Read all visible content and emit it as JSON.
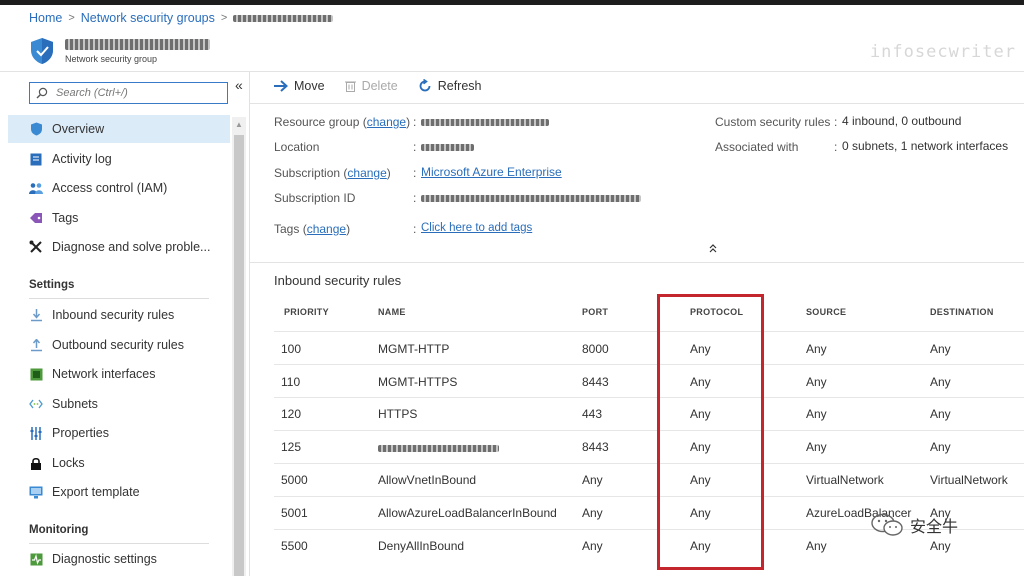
{
  "breadcrumb": {
    "home": "Home",
    "section": "Network security groups"
  },
  "resource": {
    "subtitle": "Network security group"
  },
  "watermark_top": "infosecwriter",
  "watermark_bottom": "安全牛",
  "sidebar": {
    "search_placeholder": "Search (Ctrl+/)",
    "collapse": "«",
    "items": [
      {
        "label": "Overview",
        "icon": "shield-icon"
      },
      {
        "label": "Activity log",
        "icon": "activity-log-icon"
      },
      {
        "label": "Access control (IAM)",
        "icon": "people-icon"
      },
      {
        "label": "Tags",
        "icon": "tag-icon"
      },
      {
        "label": "Diagnose and solve proble...",
        "icon": "wrench-icon"
      }
    ],
    "settings_title": "Settings",
    "settings_items": [
      {
        "label": "Inbound security rules",
        "icon": "inbound-icon"
      },
      {
        "label": "Outbound security rules",
        "icon": "outbound-icon"
      },
      {
        "label": "Network interfaces",
        "icon": "network-interface-icon"
      },
      {
        "label": "Subnets",
        "icon": "subnet-icon"
      },
      {
        "label": "Properties",
        "icon": "properties-icon"
      },
      {
        "label": "Locks",
        "icon": "lock-icon"
      },
      {
        "label": "Export template",
        "icon": "export-icon"
      }
    ],
    "monitoring_title": "Monitoring",
    "monitoring_items": [
      {
        "label": "Diagnostic settings",
        "icon": "diagnostic-icon"
      }
    ]
  },
  "toolbar": {
    "move": "Move",
    "delete": "Delete",
    "refresh": "Refresh"
  },
  "essentials": {
    "resource_group_label": "Resource group",
    "change": "change",
    "location_label": "Location",
    "subscription_label": "Subscription",
    "subscription_value": "Microsoft Azure Enterprise",
    "subscription_id_label": "Subscription ID",
    "tags_label": "Tags",
    "tags_value": "Click here to add tags",
    "custom_rules_label": "Custom security rules",
    "custom_rules_value": "4 inbound, 0 outbound",
    "associated_label": "Associated with",
    "associated_value": "0 subnets, 1 network interfaces",
    "colon": ":",
    "open_paren": "(",
    "close_paren": ")"
  },
  "inbound": {
    "heading": "Inbound security rules",
    "columns": [
      "PRIORITY",
      "NAME",
      "PORT",
      "PROTOCOL",
      "SOURCE",
      "DESTINATION"
    ],
    "rows": [
      {
        "priority": "100",
        "name": "MGMT-HTTP",
        "port": "8000",
        "protocol": "Any",
        "source": "Any",
        "destination": "Any"
      },
      {
        "priority": "110",
        "name": "MGMT-HTTPS",
        "port": "8443",
        "protocol": "Any",
        "source": "Any",
        "destination": "Any"
      },
      {
        "priority": "120",
        "name": "HTTPS",
        "port": "443",
        "protocol": "Any",
        "source": "Any",
        "destination": "Any"
      },
      {
        "priority": "125",
        "name": "",
        "port": "8443",
        "protocol": "Any",
        "source": "Any",
        "destination": "Any"
      },
      {
        "priority": "5000",
        "name": "AllowVnetInBound",
        "port": "Any",
        "protocol": "Any",
        "source": "VirtualNetwork",
        "destination": "VirtualNetwork"
      },
      {
        "priority": "5001",
        "name": "AllowAzureLoadBalancerInBound",
        "port": "Any",
        "protocol": "Any",
        "source": "AzureLoadBalancer",
        "destination": "Any"
      },
      {
        "priority": "5500",
        "name": "DenyAllInBound",
        "port": "Any",
        "protocol": "Any",
        "source": "Any",
        "destination": "Any"
      }
    ]
  },
  "colors": {
    "link": "#2a6ebb",
    "highlight": "#c4262e",
    "active_nav": "#dcebf8"
  }
}
